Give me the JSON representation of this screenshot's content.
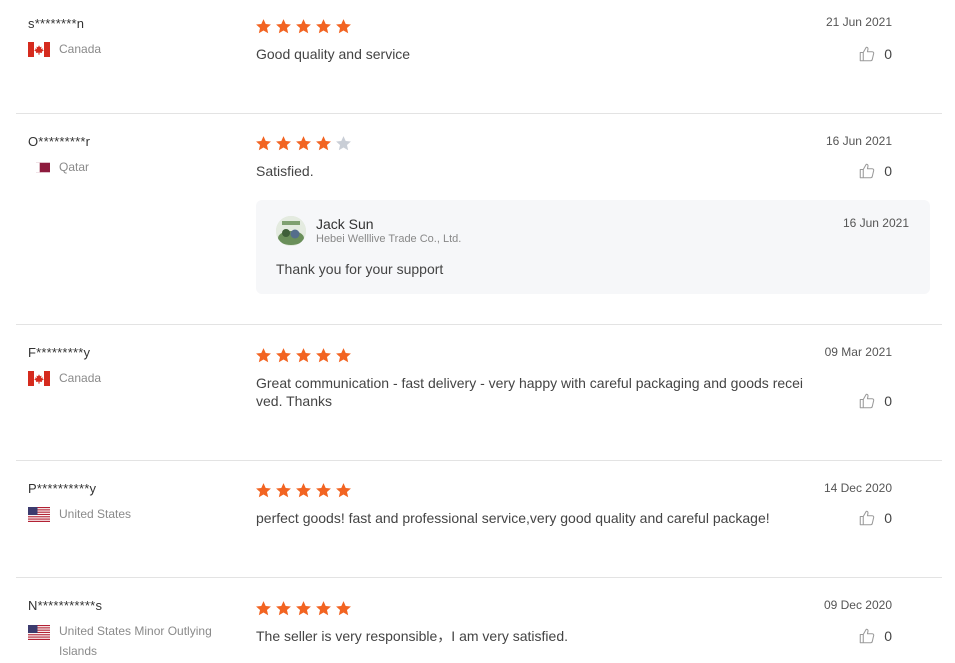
{
  "colors": {
    "star_on": "#f26422",
    "star_off": "#c9ced6",
    "divider": "#e3e3e3"
  },
  "icons": {
    "like": "thumbs-up-icon",
    "star": "star-icon"
  },
  "reviews": [
    {
      "user": "s********n",
      "country": "Canada",
      "flag": "canada-flag-icon",
      "rating": 5,
      "comment": "Good quality and service",
      "date": "21 Jun 2021",
      "likes": "0"
    },
    {
      "user": "O*********r",
      "country": "Qatar",
      "flag": "qatar-flag-icon",
      "rating": 4,
      "comment": "Satisfied.",
      "date": "16 Jun 2021",
      "likes": "0",
      "reply": {
        "name": "Jack Sun",
        "company": "Hebei Welllive Trade Co., Ltd.",
        "date": "16 Jun 2021",
        "text": "Thank you for your support"
      }
    },
    {
      "user": "F*********y",
      "country": "Canada",
      "flag": "canada-flag-icon",
      "rating": 5,
      "comment": "Great communication - fast delivery - very happy with careful packaging and goods received.  Thanks",
      "date": "09 Mar 2021",
      "likes": "0"
    },
    {
      "user": "P**********y",
      "country": "United States",
      "flag": "us-flag-icon",
      "rating": 5,
      "comment": "perfect goods! fast and professional service,very good quality and careful package!",
      "date": "14 Dec 2020",
      "likes": "0"
    },
    {
      "user": "N***********s",
      "country": "United States Minor Outlying Islands",
      "flag": "us-flag-icon",
      "rating": 5,
      "comment": "The seller is very responsible，I am very satisfied.",
      "date": "09 Dec 2020",
      "likes": "0"
    }
  ]
}
